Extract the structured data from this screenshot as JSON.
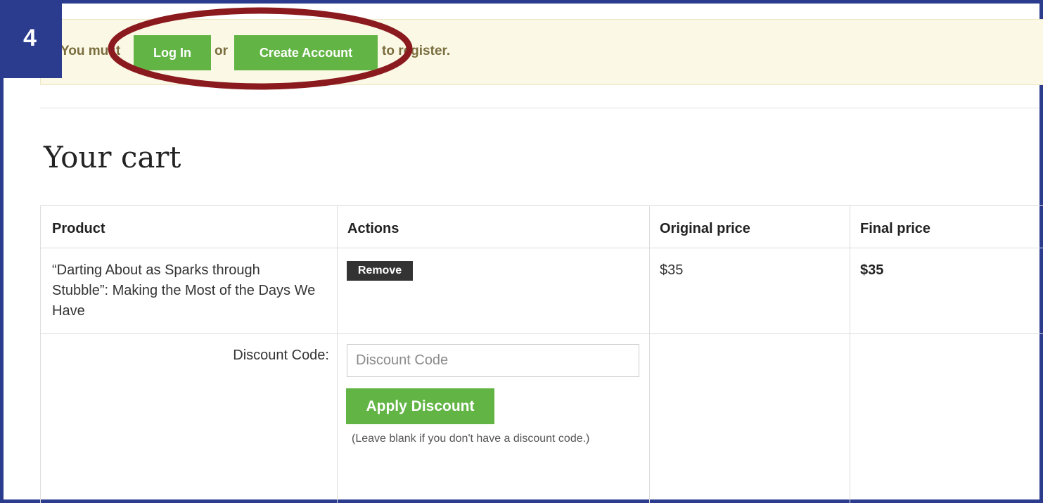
{
  "notice": {
    "prefix": "You must",
    "login_label": "Log In",
    "connector": "or",
    "create_label": "Create Account",
    "suffix": "to register."
  },
  "step_badge": "4",
  "page_title": "Your cart",
  "cart_table": {
    "headers": [
      "Product",
      "Actions",
      "Original price",
      "Final price"
    ],
    "rows": [
      {
        "product": "“Darting About as Sparks through Stubble”: Making the Most of the Days We Have",
        "action_label": "Remove",
        "original_price": "$35",
        "final_price": "$35"
      }
    ]
  },
  "discount": {
    "label": "Discount Code:",
    "placeholder": "Discount Code",
    "value": "",
    "apply_label": "Apply Discount",
    "hint": "(Leave blank if you don't have a discount code.)"
  },
  "colors": {
    "frame": "#2b3c8f",
    "green_button": "#62b545",
    "highlight_ellipse": "#8b1a1f",
    "notice_bg": "#fbf8e5"
  }
}
